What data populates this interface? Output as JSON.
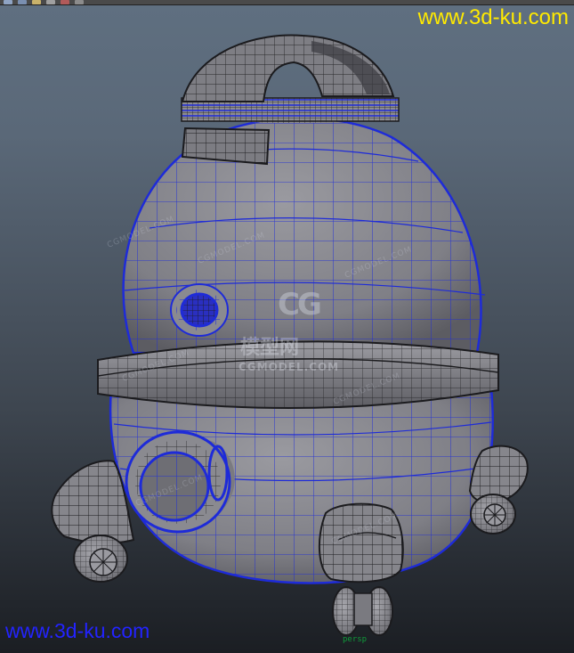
{
  "toolbar": {
    "icons": [
      "grid-icon",
      "camera-icon",
      "light-icon",
      "render-icon",
      "isolate-icon",
      "xray-icon"
    ]
  },
  "watermarks": {
    "top_url": "www.3d-ku.com",
    "bottom_url": "www.3d-ku.com",
    "logo": "CG",
    "cn_text": "模型网",
    "sub_text": "CGMODEL.COM",
    "diag_text": "CGMODEL.COM"
  },
  "viewport": {
    "camera_label": "persp",
    "wire_color": "#1e2bd8",
    "mesh_color": "#8a8a8e",
    "watermark_color": "#ffea00",
    "bottom_watermark_color": "#2323ff"
  }
}
